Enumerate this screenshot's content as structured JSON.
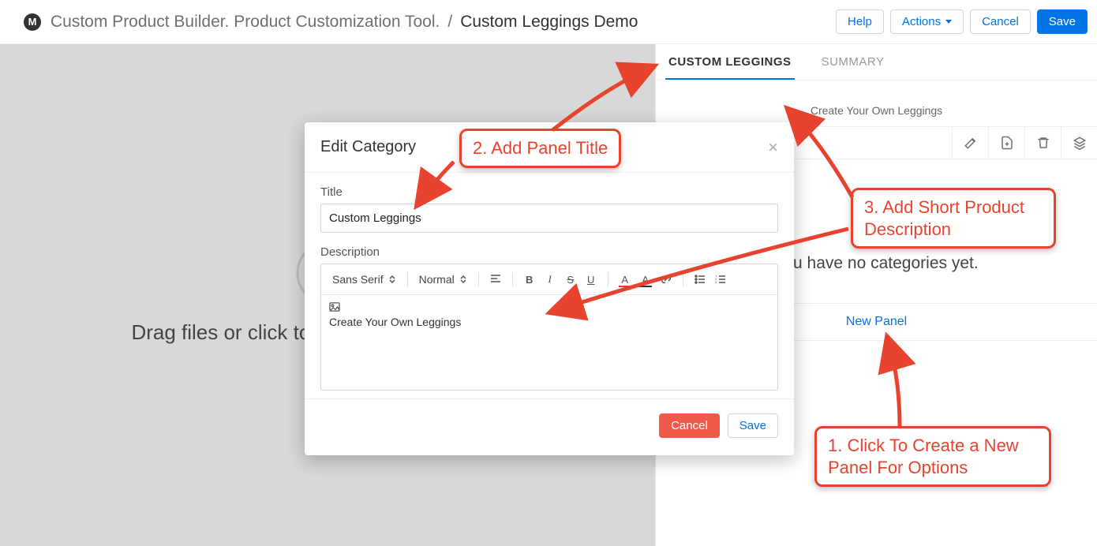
{
  "header": {
    "app_name": "Custom Product Builder. Product Customization Tool.",
    "breadcrumb_sep": "/",
    "current": "Custom Leggings Demo",
    "buttons": {
      "help": "Help",
      "actions": "Actions",
      "cancel": "Cancel",
      "save": "Save"
    }
  },
  "dropzone": {
    "text": "Drag files or click to upload product images"
  },
  "right": {
    "tabs": [
      {
        "label": "CUSTOM LEGGINGS",
        "active": true
      },
      {
        "label": "SUMMARY",
        "active": false
      }
    ],
    "subheading": "Create Your Own Leggings",
    "empty": "You have no categories yet.",
    "new_panel": "New Panel"
  },
  "modal": {
    "title": "Edit Category",
    "fields": {
      "title_label": "Title",
      "title_value": "Custom Leggings",
      "description_label": "Description",
      "description_value": "Create Your Own Leggings"
    },
    "rte": {
      "font": "Sans Serif",
      "size": "Normal"
    },
    "buttons": {
      "cancel": "Cancel",
      "save": "Save"
    }
  },
  "annotations": {
    "step1": "1. Click To Create a New Panel For Options",
    "step2": "2. Add Panel Title",
    "step3": "3. Add Short Product Description"
  }
}
